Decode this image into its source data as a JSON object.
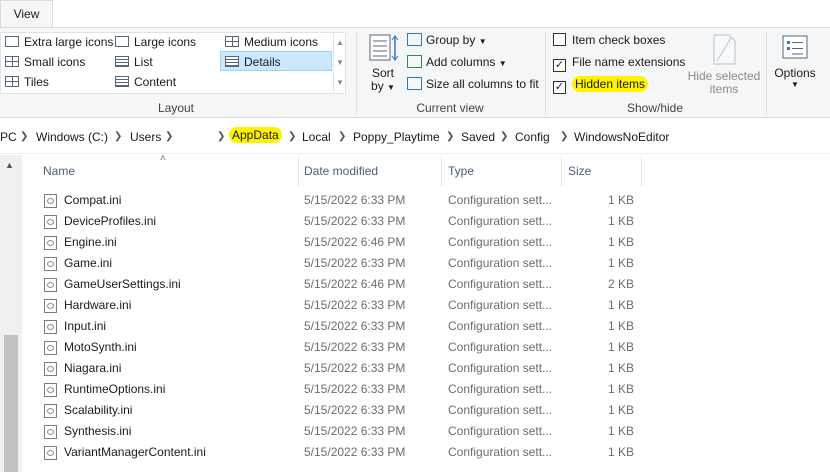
{
  "tabs": {
    "view": "View"
  },
  "layout": {
    "items": [
      {
        "label": "Extra large icons"
      },
      {
        "label": "Large icons"
      },
      {
        "label": "Medium icons"
      },
      {
        "label": "Small icons"
      },
      {
        "label": "List"
      },
      {
        "label": "Details"
      },
      {
        "label": "Tiles"
      },
      {
        "label": "Content"
      }
    ],
    "group_label": "Layout",
    "selected": "Details"
  },
  "current_view": {
    "sort_label": "Sort",
    "sort_by": "by",
    "group_by": "Group by",
    "add_columns": "Add columns",
    "size_all": "Size all columns to fit",
    "group_label": "Current view"
  },
  "show_hide": {
    "item_check_boxes": {
      "label": "Item check boxes",
      "checked": false
    },
    "file_name_extensions": {
      "label": "File name extensions",
      "checked": true
    },
    "hidden_items": {
      "label": "Hidden items",
      "checked": true
    },
    "hide_selected_line1": "Hide selected",
    "hide_selected_line2": "items",
    "group_label": "Show/hide"
  },
  "options": {
    "label": "Options"
  },
  "breadcrumb": [
    "PC",
    "Windows (C:)",
    "Users",
    "AppData",
    "Local",
    "Poppy_Playtime",
    "Saved",
    "Config",
    "WindowsNoEditor"
  ],
  "columns": {
    "name": "Name",
    "date": "Date modified",
    "type": "Type",
    "size": "Size"
  },
  "files": [
    {
      "name": "Compat.ini",
      "date": "5/15/2022 6:33 PM",
      "type": "Configuration sett...",
      "size": "1 KB"
    },
    {
      "name": "DeviceProfiles.ini",
      "date": "5/15/2022 6:33 PM",
      "type": "Configuration sett...",
      "size": "1 KB"
    },
    {
      "name": "Engine.ini",
      "date": "5/15/2022 6:46 PM",
      "type": "Configuration sett...",
      "size": "1 KB"
    },
    {
      "name": "Game.ini",
      "date": "5/15/2022 6:33 PM",
      "type": "Configuration sett...",
      "size": "1 KB"
    },
    {
      "name": "GameUserSettings.ini",
      "date": "5/15/2022 6:46 PM",
      "type": "Configuration sett...",
      "size": "2 KB"
    },
    {
      "name": "Hardware.ini",
      "date": "5/15/2022 6:33 PM",
      "type": "Configuration sett...",
      "size": "1 KB"
    },
    {
      "name": "Input.ini",
      "date": "5/15/2022 6:33 PM",
      "type": "Configuration sett...",
      "size": "1 KB"
    },
    {
      "name": "MotoSynth.ini",
      "date": "5/15/2022 6:33 PM",
      "type": "Configuration sett...",
      "size": "1 KB"
    },
    {
      "name": "Niagara.ini",
      "date": "5/15/2022 6:33 PM",
      "type": "Configuration sett...",
      "size": "1 KB"
    },
    {
      "name": "RuntimeOptions.ini",
      "date": "5/15/2022 6:33 PM",
      "type": "Configuration sett...",
      "size": "1 KB"
    },
    {
      "name": "Scalability.ini",
      "date": "5/15/2022 6:33 PM",
      "type": "Configuration sett...",
      "size": "1 KB"
    },
    {
      "name": "Synthesis.ini",
      "date": "5/15/2022 6:33 PM",
      "type": "Configuration sett...",
      "size": "1 KB"
    },
    {
      "name": "VariantManagerContent.ini",
      "date": "5/15/2022 6:33 PM",
      "type": "Configuration sett...",
      "size": "1 KB"
    }
  ],
  "colors": {
    "highlight": "#fff200",
    "selection": "#cce8ff",
    "header_text": "#4c607a"
  }
}
